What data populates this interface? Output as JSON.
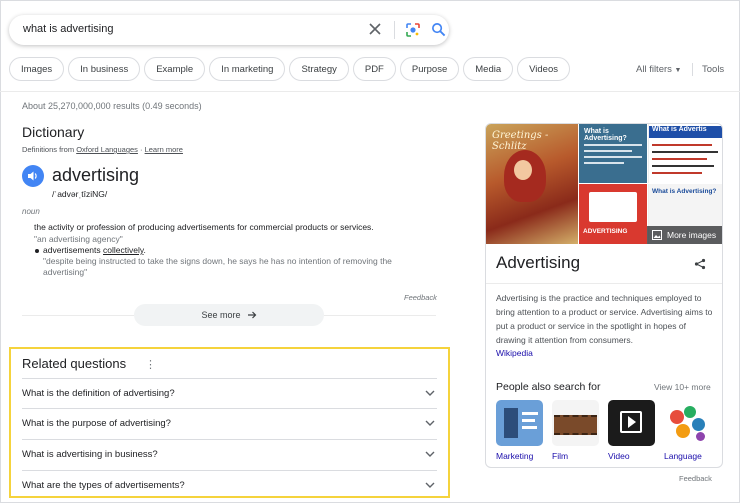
{
  "search": {
    "query": "what is advertising"
  },
  "chips": [
    "Images",
    "In business",
    "Example",
    "In marketing",
    "Strategy",
    "PDF",
    "Purpose",
    "Media",
    "Videos"
  ],
  "toolbar": {
    "all_filters": "All filters",
    "tools": "Tools"
  },
  "results_count": "About 25,270,000,000 results (0.49 seconds)",
  "dictionary": {
    "title": "Dictionary",
    "source_prefix": "Definitions from",
    "source_name": "Oxford Languages",
    "learn_more": "Learn more",
    "word": "advertising",
    "phonetic": "/ˈadvərˌtīziNG/",
    "part_of_speech": "noun",
    "definition": "the activity or profession of producing advertisements for commercial products or services.",
    "example": "\"an advertising agency\"",
    "sub_sense_prefix": "advertisements",
    "sub_sense_link": "collectively",
    "sub_example": "\"despite being instructed to take the signs down, he says he has no intention of removing the advertising\"",
    "feedback": "Feedback",
    "see_more": "See more"
  },
  "related": {
    "title": "Related questions",
    "questions": [
      "What is the definition of advertising?",
      "What is the purpose of advertising?",
      "What is advertising in business?",
      "What are the types of advertisements?"
    ]
  },
  "knowledge_panel": {
    "more_images": "More images",
    "title": "Advertising",
    "description": "Advertising is the practice and techniques employed to bring attention to a product or service. Advertising aims to put a product or service in the spotlight in hopes of drawing it attention from consumers.",
    "wiki_link": "Wikipedia",
    "img_main_text": "Greetings - Schlitz",
    "img_tl_text": "What is Advertising?",
    "img_tr_text": "What is Advertis",
    "img_bl_text": "ADVERTISING",
    "img_br_text": "What is Advertising?",
    "people_also_search": {
      "title": "People also search for",
      "view_more": "View 10+ more",
      "items": [
        "Marketing",
        "Film",
        "Video",
        "Language"
      ]
    },
    "feedback": "Feedback"
  },
  "colors": {
    "highlight_box": "#f5d33c",
    "link": "#1a0dab",
    "accent_blue": "#4285f4"
  }
}
